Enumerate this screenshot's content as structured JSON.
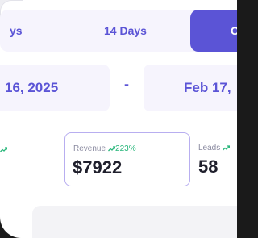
{
  "range_tabs": [
    {
      "label": "ys"
    },
    {
      "label": "14 Days"
    },
    {
      "label": "C"
    }
  ],
  "date_range": {
    "start": "16, 2025",
    "separator": "-",
    "end": "Feb 17,"
  },
  "stats": [
    {
      "label": "Revenue",
      "change": "223%",
      "value": "$7922"
    },
    {
      "label": "Leads",
      "change": "",
      "value": "58"
    }
  ],
  "colors": {
    "accent": "#5b54d6",
    "tab_background": "#f6f4fd",
    "trend_up": "#27b67a",
    "card_border": "#b8aef0"
  },
  "icons": {
    "trend": "trending-up-icon"
  }
}
